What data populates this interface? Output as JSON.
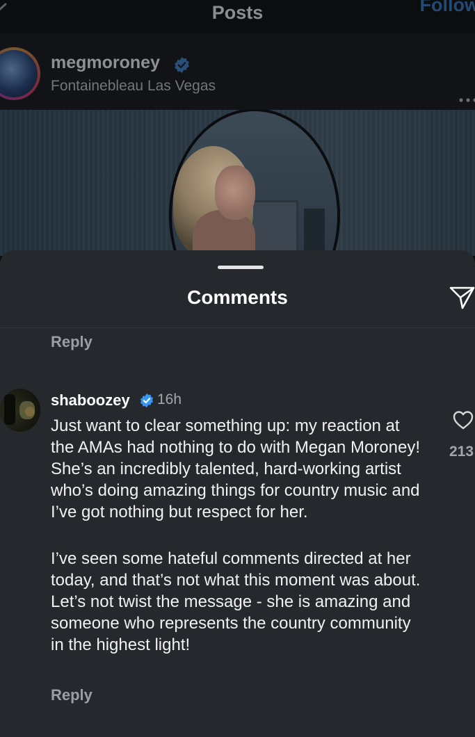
{
  "header": {
    "title": "Posts",
    "follow_label": "Follow"
  },
  "post": {
    "username": "megmoroney",
    "location": "Fontainebleau Las Vegas"
  },
  "comments_sheet": {
    "title": "Comments",
    "reply_label": "Reply",
    "comment": {
      "username": "shaboozey",
      "time": "16h",
      "paragraph_1": "Just want to clear something up: my reaction at the AMAs had nothing to do with Megan Moroney! She’s an incredibly talented, hard-working artist who’s doing amazing things for country music and I’ve got nothing but respect for her.",
      "paragraph_2": "I’ve seen some hateful comments directed at her today, and that’s not what this moment was about. Let’s not twist the message - she is amazing and someone who represents the country community in the highest light!",
      "like_count": "213",
      "reply_label": "Reply"
    }
  },
  "colors": {
    "sheet_background": "#25282d",
    "verified_blue": "#3797f0",
    "text_primary": "#ffffff",
    "text_secondary": "#a4a6ab"
  },
  "icons": [
    "back-icon",
    "verified-icon",
    "more-icon",
    "share-icon",
    "like-icon"
  ]
}
